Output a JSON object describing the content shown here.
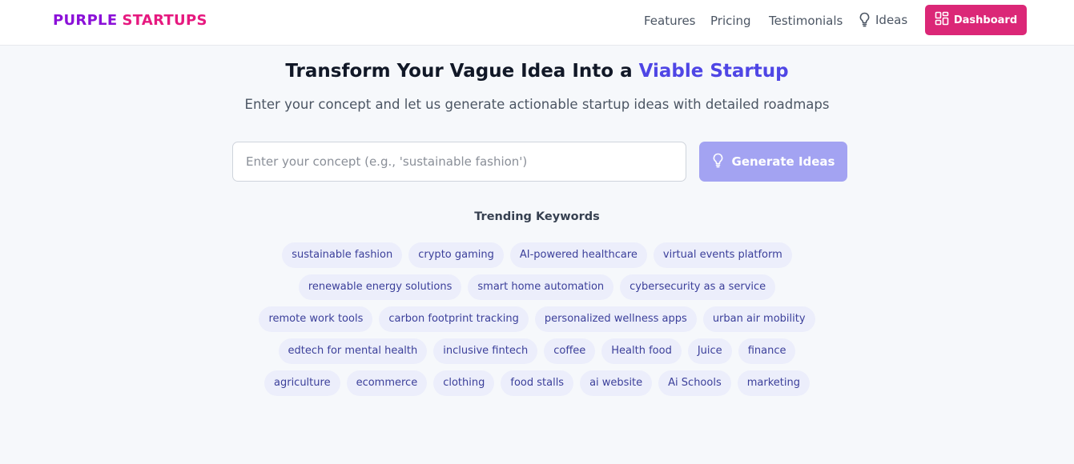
{
  "brand": {
    "part1": "PURPLE",
    "part2": "STARTUPS",
    "color1": "#8b10d8",
    "color2": "#e6197f"
  },
  "nav": {
    "features": "Features",
    "pricing": "Pricing",
    "testimonials": "Testimonials",
    "ideas": {
      "label": "Ideas",
      "icon": "lightbulb-icon"
    },
    "dashboard": {
      "label": "Dashboard",
      "icon": "layout-grid-icon",
      "color": "#db2777"
    }
  },
  "hero": {
    "title_start": "Transform Your Vague Idea Into a ",
    "title_accent": "Viable Startup",
    "accent_color": "#4f46e5",
    "subtitle": "Enter your concept and let us generate actionable startup ideas with detailed roadmaps"
  },
  "search": {
    "placeholder": "Enter your concept (e.g., 'sustainable fashion')",
    "value": "",
    "button_label": "Generate Ideas",
    "button_icon": "lightbulb-icon",
    "button_color": "#a3a3f2"
  },
  "trending": {
    "title": "Trending Keywords",
    "keywords": [
      "sustainable fashion",
      "crypto gaming",
      "AI-powered healthcare",
      "virtual events platform",
      "renewable energy solutions",
      "smart home automation",
      "cybersecurity as a service",
      "remote work tools",
      "carbon footprint tracking",
      "personalized wellness apps",
      "urban air mobility",
      "edtech for mental health",
      "inclusive fintech",
      "coffee",
      "Health food",
      "Juice",
      "finance",
      "agriculture",
      "ecommerce",
      "clothing",
      "food stalls",
      "ai website",
      "Ai Schools",
      "marketing"
    ]
  }
}
